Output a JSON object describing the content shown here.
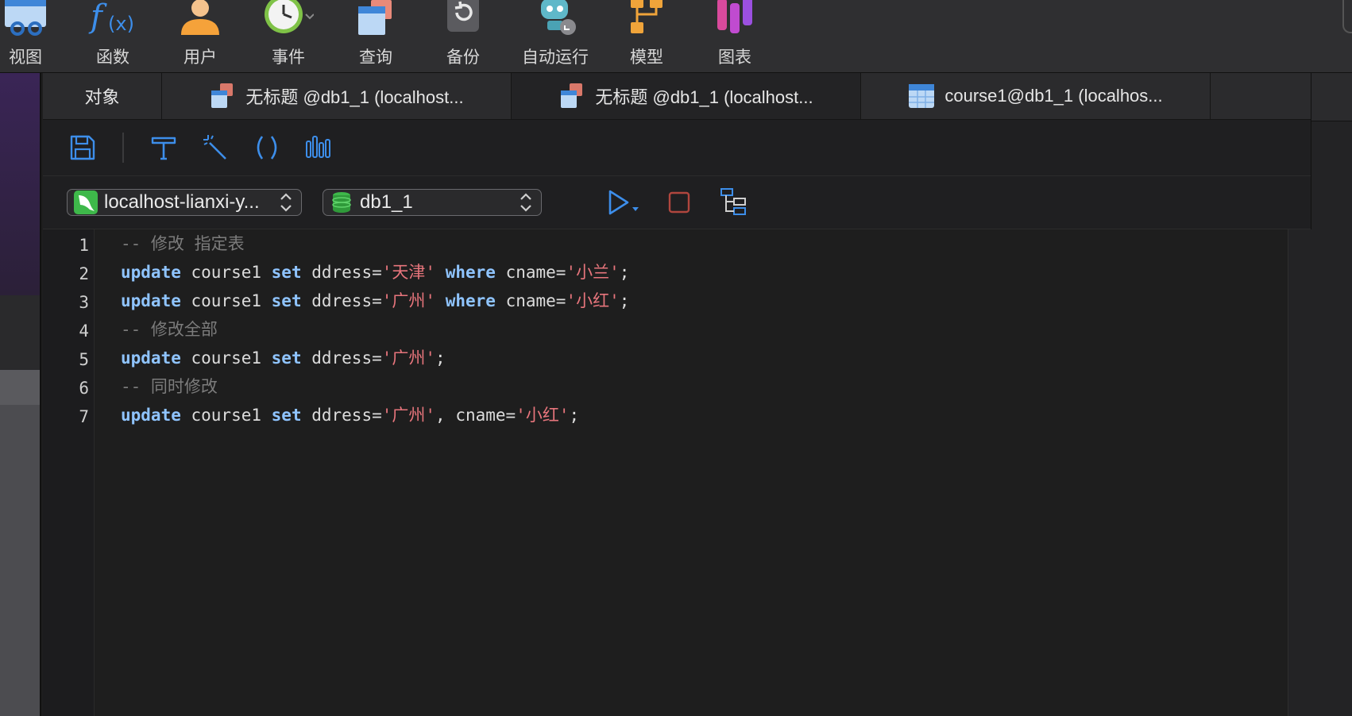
{
  "toolbar": {
    "items": [
      {
        "label": "视图",
        "icon": "view-icon"
      },
      {
        "label": "函数",
        "icon": "function-icon"
      },
      {
        "label": "用户",
        "icon": "user-icon"
      },
      {
        "label": "事件",
        "icon": "event-clock-icon"
      },
      {
        "label": "查询",
        "icon": "query-icon"
      },
      {
        "label": "备份",
        "icon": "backup-icon"
      },
      {
        "label": "自动运行",
        "icon": "automation-robot-icon"
      },
      {
        "label": "模型",
        "icon": "model-icon"
      },
      {
        "label": "图表",
        "icon": "chart-icon"
      }
    ]
  },
  "tabs": [
    {
      "label": "对象"
    },
    {
      "label": "无标题 @db1_1 (localhost..."
    },
    {
      "label": "无标题 @db1_1 (localhost..."
    },
    {
      "label": "course1@db1_1 (localhos..."
    }
  ],
  "connection": {
    "server": "localhost-lianxi-y...",
    "database": "db1_1"
  },
  "editor": {
    "line_numbers": [
      "1",
      "2",
      "3",
      "4",
      "5",
      "6",
      "7"
    ],
    "lines": [
      [
        {
          "t": "-- 修改 指定表",
          "c": "cm"
        }
      ],
      [
        {
          "t": "update",
          "c": "kw"
        },
        {
          "t": " course1 ",
          "c": ""
        },
        {
          "t": "set",
          "c": "kw"
        },
        {
          "t": " ddress=",
          "c": ""
        },
        {
          "t": "'天津'",
          "c": "str"
        },
        {
          "t": " ",
          "c": ""
        },
        {
          "t": "where",
          "c": "kw"
        },
        {
          "t": " cname=",
          "c": ""
        },
        {
          "t": "'小兰'",
          "c": "str"
        },
        {
          "t": ";",
          "c": ""
        }
      ],
      [
        {
          "t": "update",
          "c": "kw"
        },
        {
          "t": " course1 ",
          "c": ""
        },
        {
          "t": "set",
          "c": "kw"
        },
        {
          "t": " ddress=",
          "c": ""
        },
        {
          "t": "'广州'",
          "c": "str"
        },
        {
          "t": " ",
          "c": ""
        },
        {
          "t": "where",
          "c": "kw"
        },
        {
          "t": " cname=",
          "c": ""
        },
        {
          "t": "'小红'",
          "c": "str"
        },
        {
          "t": ";",
          "c": ""
        }
      ],
      [
        {
          "t": "-- 修改全部",
          "c": "cm"
        }
      ],
      [
        {
          "t": "update",
          "c": "kw"
        },
        {
          "t": " course1 ",
          "c": ""
        },
        {
          "t": "set",
          "c": "kw"
        },
        {
          "t": " ddress=",
          "c": ""
        },
        {
          "t": "'广州'",
          "c": "str"
        },
        {
          "t": ";",
          "c": ""
        }
      ],
      [
        {
          "t": "-- 同时修改",
          "c": "cm"
        }
      ],
      [
        {
          "t": "update",
          "c": "kw"
        },
        {
          "t": " course1 ",
          "c": ""
        },
        {
          "t": "set",
          "c": "kw"
        },
        {
          "t": " ddress=",
          "c": ""
        },
        {
          "t": "'广州'",
          "c": "str"
        },
        {
          "t": ", cname=",
          "c": ""
        },
        {
          "t": "'小红'",
          "c": "str"
        },
        {
          "t": ";",
          "c": ""
        }
      ]
    ]
  },
  "colors": {
    "keyword": "#8fc4ff",
    "string": "#e7757c",
    "comment": "#7c7c7c",
    "accent_blue": "#3d8eea",
    "stop_red": "#b0463e"
  }
}
